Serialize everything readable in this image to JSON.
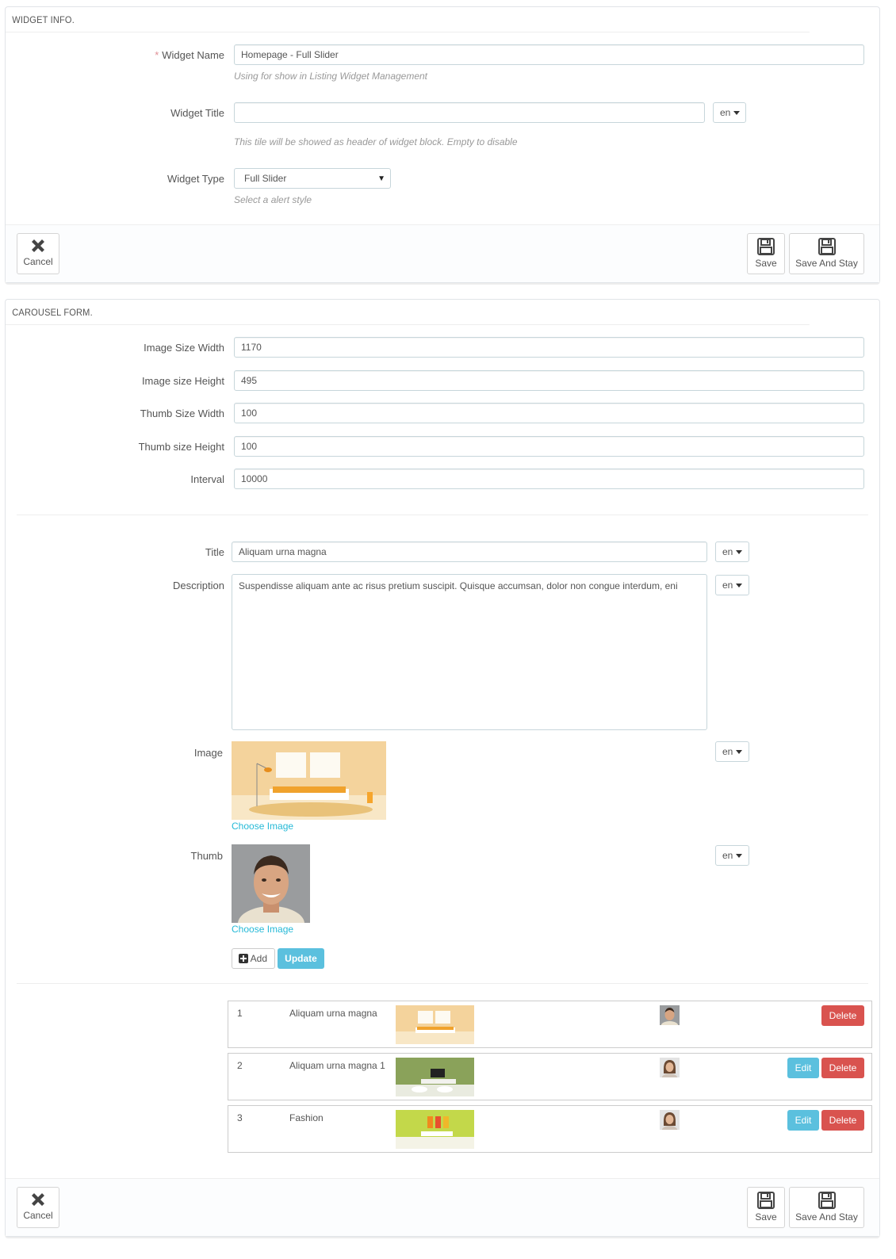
{
  "widget_panel": {
    "heading": "WIDGET INFO.",
    "widget_name": {
      "required_mark": "*",
      "label": "Widget Name",
      "value": "Homepage - Full Slider",
      "help": "Using for show in Listing Widget Management"
    },
    "widget_title": {
      "label": "Widget Title",
      "value": "",
      "lang": "en",
      "help": "This tile will be showed as header of widget block. Empty to disable"
    },
    "widget_type": {
      "label": "Widget Type",
      "selected": "Full Slider",
      "help": "Select a alert style"
    },
    "footer": {
      "cancel": "Cancel",
      "save": "Save",
      "save_and_stay": "Save And Stay"
    }
  },
  "carousel_panel": {
    "heading": "CAROUSEL FORM.",
    "fields": {
      "image_width": {
        "label": "Image Size Width",
        "value": "1170"
      },
      "image_height": {
        "label": "Image size Height",
        "value": "495"
      },
      "thumb_width": {
        "label": "Thumb Size Width",
        "value": "100"
      },
      "thumb_height": {
        "label": "Thumb size Height",
        "value": "100"
      },
      "interval": {
        "label": "Interval",
        "value": "10000"
      }
    },
    "slide_form": {
      "title": {
        "label": "Title",
        "value": "Aliquam urna magna",
        "lang": "en"
      },
      "description": {
        "label": "Description",
        "value": "Suspendisse aliquam ante ac risus pretium suscipit. Quisque accumsan, dolor non congue interdum, eni",
        "lang": "en"
      },
      "image": {
        "label": "Image",
        "link": "Choose Image",
        "lang": "en"
      },
      "thumb": {
        "label": "Thumb",
        "link": "Choose Image",
        "lang": "en"
      },
      "add_label": "Add",
      "update_label": "Update"
    },
    "slides": [
      {
        "num": "1",
        "title": "Aliquam urna magna",
        "edit": "",
        "delete": "Delete"
      },
      {
        "num": "2",
        "title": "Aliquam urna magna 1",
        "edit": "Edit",
        "delete": "Delete"
      },
      {
        "num": "3",
        "title": "Fashion",
        "edit": "Edit",
        "delete": "Delete"
      }
    ],
    "footer": {
      "cancel": "Cancel",
      "save": "Save",
      "save_and_stay": "Save And Stay"
    }
  }
}
